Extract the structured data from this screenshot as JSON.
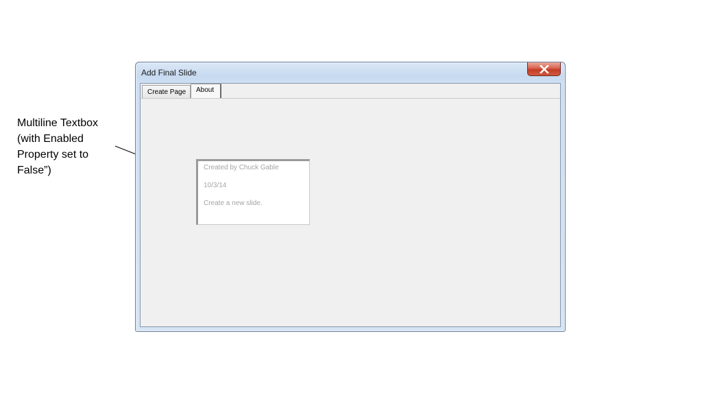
{
  "annotation": {
    "lines": [
      "Multiline Textbox",
      "(with Enabled",
      "Property set to",
      "False”)"
    ]
  },
  "window": {
    "title": "Add Final Slide",
    "close_icon": "close-x-icon"
  },
  "tabs": [
    {
      "label": "Create Page",
      "selected": false
    },
    {
      "label": "About",
      "selected": true
    }
  ],
  "textbox": {
    "enabled": false,
    "lines": [
      "Created by Chuck Gable",
      "10/3/14",
      "Create a new slide."
    ]
  },
  "colors": {
    "close_button": "#c8412b",
    "title_bar": "#c7daf0",
    "client_bg": "#f0f0f0",
    "disabled_text": "#a4a4a4"
  }
}
